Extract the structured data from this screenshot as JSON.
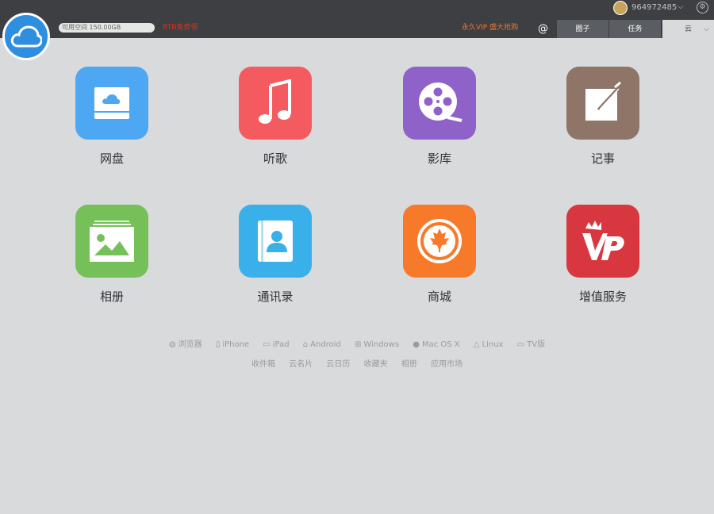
{
  "header": {
    "space_label": "可用空间 150.00GB",
    "promo_left": "8TB免费领",
    "promo_right": "永久VIP 盛大抢购",
    "at_symbol": "@",
    "tabs": [
      {
        "label": "圈子",
        "active": false
      },
      {
        "label": "任务",
        "active": false
      },
      {
        "label": "云",
        "active": true
      }
    ],
    "user_id": "964972485",
    "colors": {
      "topbar": "#3d3f42",
      "brand": "#2e8ee0",
      "promo_left": "#e0301e",
      "promo_right": "#f0762a"
    }
  },
  "apps": [
    {
      "label": "网盘",
      "icon": "cloud-drive-icon",
      "color": "#4ea7f2"
    },
    {
      "label": "听歌",
      "icon": "music-note-icon",
      "color": "#f45b60"
    },
    {
      "label": "影库",
      "icon": "film-reel-icon",
      "color": "#8e62c9"
    },
    {
      "label": "记事",
      "icon": "notepad-icon",
      "color": "#8e7568"
    },
    {
      "label": "相册",
      "icon": "photo-icon",
      "color": "#76c05a"
    },
    {
      "label": "通讯录",
      "icon": "contacts-icon",
      "color": "#3ab0ea"
    },
    {
      "label": "商城",
      "icon": "maple-leaf-icon",
      "color": "#f77a2a"
    },
    {
      "label": "增值服务",
      "icon": "vip-icon",
      "color": "#d9373f"
    }
  ],
  "platforms": [
    {
      "label": "浏览器",
      "icon": "globe-icon"
    },
    {
      "label": "iPhone",
      "icon": "phone-icon"
    },
    {
      "label": "iPad",
      "icon": "tablet-icon"
    },
    {
      "label": "Android",
      "icon": "android-icon"
    },
    {
      "label": "Windows",
      "icon": "windows-icon"
    },
    {
      "label": "Mac OS X",
      "icon": "apple-icon"
    },
    {
      "label": "Linux",
      "icon": "linux-icon"
    },
    {
      "label": "TV版",
      "icon": "tv-icon"
    }
  ],
  "links": [
    "收件箱",
    "云名片",
    "云日历",
    "收藏夹",
    "相册",
    "应用市场"
  ]
}
